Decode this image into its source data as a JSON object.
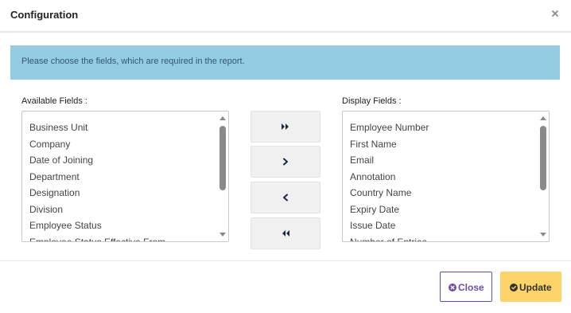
{
  "dialog": {
    "title": "Configuration",
    "close_icon": "times-icon"
  },
  "info": {
    "message": "Please choose the fields, which are required in the report."
  },
  "available": {
    "label": "Available Fields :",
    "items": [
      "Business Unit",
      "Company",
      "Date of Joining",
      "Department",
      "Designation",
      "Division",
      "Employee Status",
      "Employee Status Effective From"
    ]
  },
  "display": {
    "label": "Display Fields :",
    "items": [
      "Employee Number",
      "First Name",
      "Email",
      "Annotation",
      "Country Name",
      "Expiry Date",
      "Issue Date",
      "Number of Entries"
    ]
  },
  "transfer_buttons": {
    "move_all_right_icon": "double-chevron-right-icon",
    "move_right_icon": "chevron-right-icon",
    "move_left_icon": "chevron-left-icon",
    "move_all_left_icon": "double-chevron-left-icon"
  },
  "footer": {
    "close_label": "Close",
    "close_icon": "times-circle-icon",
    "update_label": "Update",
    "update_icon": "check-circle-icon"
  },
  "colors": {
    "banner_bg": "#93cce3",
    "banner_text": "#2f5870",
    "close_accent": "#6b4eaa",
    "update_bg": "#fcd46a",
    "scroll_thumb": "#8a8a8a"
  }
}
